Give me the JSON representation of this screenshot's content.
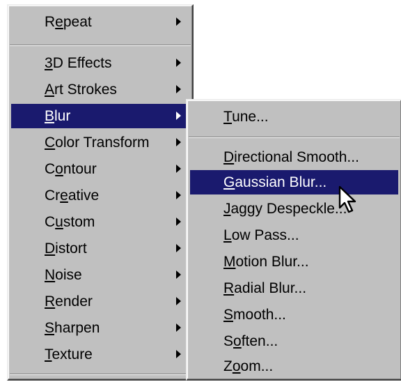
{
  "main_menu": {
    "items": [
      {
        "pre": "R",
        "u": "e",
        "post": "peat",
        "has_submenu": true
      },
      {
        "pre": "",
        "u": "3",
        "post": "D Effects",
        "has_submenu": true
      },
      {
        "pre": "",
        "u": "A",
        "post": "rt Strokes",
        "has_submenu": true
      },
      {
        "pre": "",
        "u": "B",
        "post": "lur",
        "has_submenu": true,
        "selected": true
      },
      {
        "pre": "",
        "u": "C",
        "post": "olor Transform",
        "has_submenu": true
      },
      {
        "pre": "C",
        "u": "o",
        "post": "ntour",
        "has_submenu": true
      },
      {
        "pre": "Cr",
        "u": "e",
        "post": "ative",
        "has_submenu": true
      },
      {
        "pre": "C",
        "u": "u",
        "post": "stom",
        "has_submenu": true
      },
      {
        "pre": "",
        "u": "D",
        "post": "istort",
        "has_submenu": true
      },
      {
        "pre": "",
        "u": "N",
        "post": "oise",
        "has_submenu": true
      },
      {
        "pre": "",
        "u": "R",
        "post": "ender",
        "has_submenu": true
      },
      {
        "pre": "",
        "u": "S",
        "post": "harpen",
        "has_submenu": true
      },
      {
        "pre": "",
        "u": "T",
        "post": "exture",
        "has_submenu": true
      }
    ]
  },
  "sub_menu": {
    "items": [
      {
        "pre": "",
        "u": "T",
        "post": "une..."
      },
      {
        "pre": "",
        "u": "D",
        "post": "irectional Smooth..."
      },
      {
        "pre": "",
        "u": "G",
        "post": "aussian Blur...",
        "selected": true
      },
      {
        "pre": "",
        "u": "J",
        "post": "aggy Despeckle..."
      },
      {
        "pre": "",
        "u": "L",
        "post": "ow Pass..."
      },
      {
        "pre": "",
        "u": "M",
        "post": "otion Blur..."
      },
      {
        "pre": "",
        "u": "R",
        "post": "adial Blur..."
      },
      {
        "pre": "",
        "u": "S",
        "post": "mooth..."
      },
      {
        "pre": "S",
        "u": "o",
        "post": "ften..."
      },
      {
        "pre": "Z",
        "u": "o",
        "post": "om..."
      }
    ]
  },
  "colors": {
    "menu_background": "#c0c0c0",
    "selection_background": "#1a1a6e",
    "selection_text": "#ffffff"
  },
  "icons": {
    "submenu_arrow": "triangle-right-icon",
    "pointer": "mouse-cursor-icon"
  }
}
